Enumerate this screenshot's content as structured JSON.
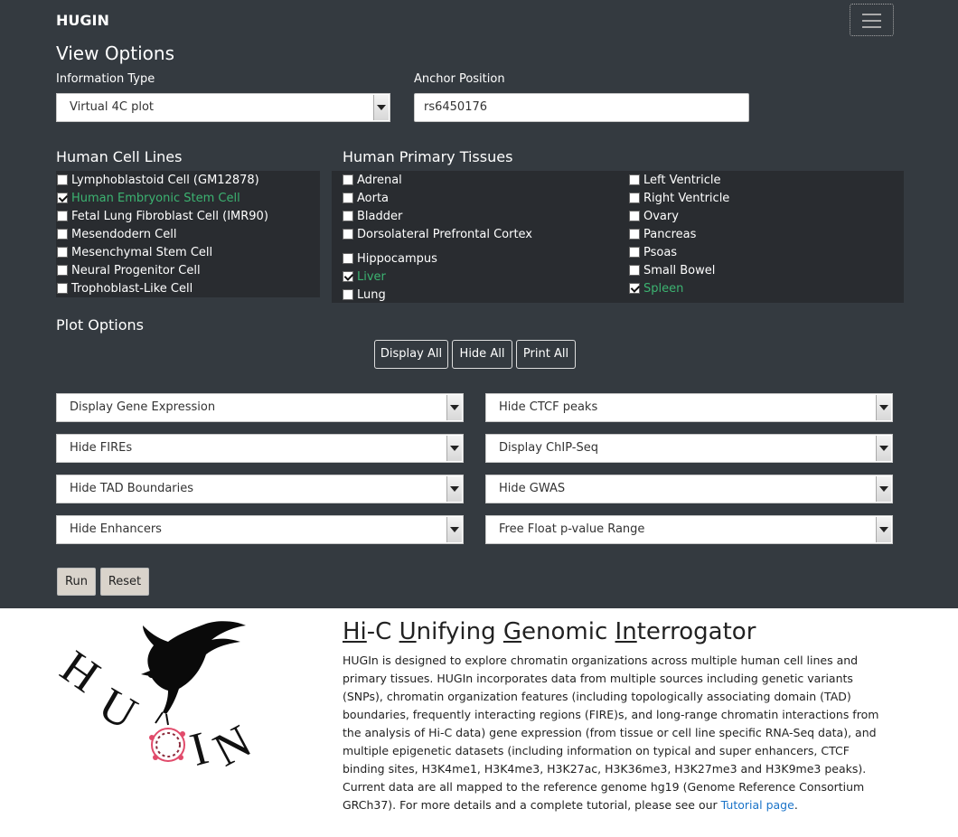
{
  "navbar": {
    "brand": "HUGIN"
  },
  "view_options": {
    "heading": "View Options",
    "info_type_label": "Information Type",
    "info_type_value": "Virtual 4C plot",
    "anchor_label": "Anchor Position",
    "anchor_value": "rs6450176"
  },
  "cell_lines": {
    "heading": "Human Cell Lines",
    "items": [
      {
        "label": "Lymphoblastoid Cell (GM12878)",
        "checked": false
      },
      {
        "label": "Human Embryonic Stem Cell",
        "checked": true
      },
      {
        "label": "Fetal Lung Fibroblast Cell (IMR90)",
        "checked": false
      },
      {
        "label": "Mesendodern Cell",
        "checked": false
      },
      {
        "label": "Mesenchymal Stem Cell",
        "checked": false
      },
      {
        "label": "Neural Progenitor Cell",
        "checked": false
      },
      {
        "label": "Trophoblast-Like Cell",
        "checked": false
      }
    ]
  },
  "tissues": {
    "heading": "Human Primary Tissues",
    "col1": [
      {
        "label": "Adrenal",
        "checked": false
      },
      {
        "label": "Aorta",
        "checked": false
      },
      {
        "label": "Bladder",
        "checked": false
      },
      {
        "label": "Dorsolateral Prefrontal Cortex",
        "checked": false
      },
      {
        "label": "Hippocampus",
        "checked": false
      },
      {
        "label": "Liver",
        "checked": true
      },
      {
        "label": "Lung",
        "checked": false
      }
    ],
    "col2": [
      {
        "label": "Left Ventricle",
        "checked": false
      },
      {
        "label": "Right Ventricle",
        "checked": false
      },
      {
        "label": "Ovary",
        "checked": false
      },
      {
        "label": "Pancreas",
        "checked": false
      },
      {
        "label": "Psoas",
        "checked": false
      },
      {
        "label": "Small Bowel",
        "checked": false
      },
      {
        "label": "Spleen",
        "checked": true
      }
    ]
  },
  "plot_options": {
    "heading": "Plot Options",
    "display_all": "Display All",
    "hide_all": "Hide All",
    "print_all": "Print All",
    "selects": [
      "Display Gene Expression",
      "Hide CTCF peaks",
      "Hide FIREs",
      "Display ChIP-Seq",
      "Hide TAD Boundaries",
      "Hide GWAS",
      "Hide Enhancers",
      "Free Float p-value Range"
    ],
    "run": "Run",
    "reset": "Reset"
  },
  "about": {
    "title_parts": [
      "Hi",
      "-C ",
      "U",
      "nifying ",
      "G",
      "enomic ",
      "In",
      "terrogator"
    ],
    "description": "HUGIn is designed to explore chromatin organizations across multiple human cell lines and primary tissues. HUGIn incorporates data from multiple sources including genetic variants (SNPs), chromatin organization features (including topologically associating domain (TAD) boundaries, frequently interacting regions (FIRE)s, and long-range chromatin interactions from the analysis of Hi-C data) gene expression (from tissue or cell line specific RNA-Seq data), and multiple epigenetic datasets (including information on typical and super enhancers, CTCF binding sites, H3K4me1, H3K4me3, H3K27ac, H3K36me3, H3K27me3 and H3K9me3 peaks). Current data are all mapped to the reference genome hg19 (Genome Reference Consortium GRCh37). For more details and a complete tutorial, please see our",
    "link_text": "Tutorial page",
    "trailing": ".",
    "logo_text": "HUGIN"
  },
  "colors": {
    "background": "#343a40",
    "panel": "#292c30",
    "checked_text": "#3cb371",
    "link": "#1a73c8"
  }
}
